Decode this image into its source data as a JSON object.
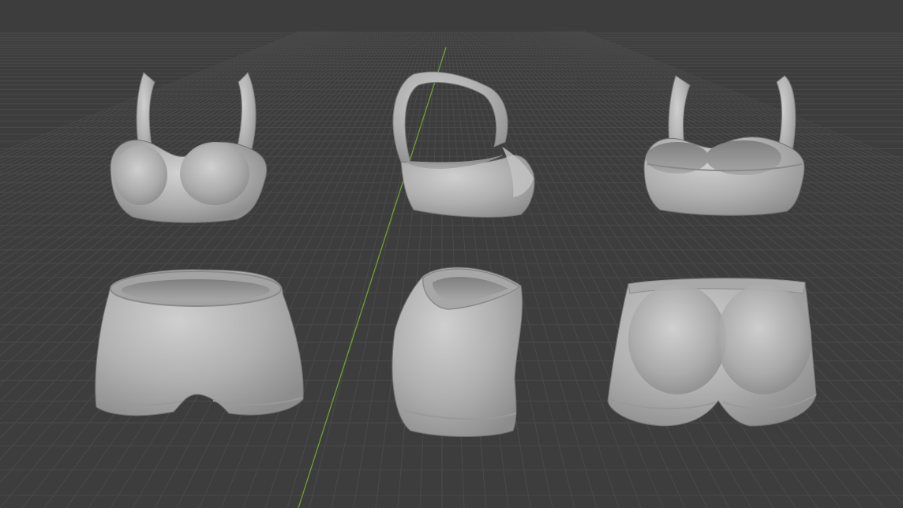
{
  "viewport": {
    "background": "#3d3d3d",
    "grid_color": "#4a4a4a",
    "y_axis_color": "#6f9a2e",
    "mesh_color": "#b3b3b3",
    "objects": [
      {
        "name": "bra-front",
        "view": "front"
      },
      {
        "name": "bra-side",
        "view": "side"
      },
      {
        "name": "bra-back",
        "view": "back"
      },
      {
        "name": "shorts-front",
        "view": "front"
      },
      {
        "name": "shorts-side",
        "view": "side"
      },
      {
        "name": "shorts-back",
        "view": "back"
      }
    ]
  }
}
